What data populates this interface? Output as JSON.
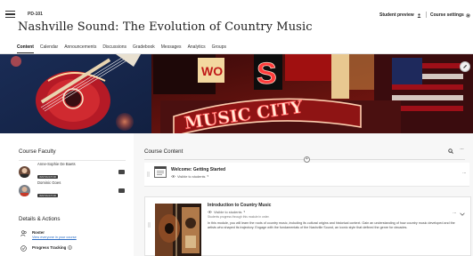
{
  "header": {
    "course_code": "PD-101",
    "course_title": "Nashville Sound: The Evolution of Country Music",
    "student_preview": "Student preview",
    "course_settings": "Course settings"
  },
  "nav": {
    "tabs": [
      "Content",
      "Calendar",
      "Announcements",
      "Discussions",
      "Gradebook",
      "Messages",
      "Analytics",
      "Groups"
    ],
    "active": "Content"
  },
  "banner": {
    "sign_top": "MUSIC",
    "sign_word": "MUSIC CITY"
  },
  "faculty": {
    "title": "Course Faculty",
    "members": [
      {
        "name": "Anne-Sophie De Baets",
        "role": "INSTRUCTOR"
      },
      {
        "name": "Dominic Goes",
        "role": "INSTRUCTOR"
      }
    ]
  },
  "details": {
    "title": "Details & Actions",
    "roster_title": "Roster",
    "roster_link": "View everyone in your course",
    "progress_title": "Progress Tracking"
  },
  "content": {
    "title": "Course Content",
    "welcome": {
      "title": "Welcome: Getting Started",
      "visibility": "Visible to students"
    },
    "intro": {
      "title": "Introduction to Country Music",
      "visibility": "Visible to students",
      "progress_note": "Students progress through this module in order.",
      "description": "In this module, you will learn the roots of country music, including its cultural origins and historical context. Gain an understanding of how country music developed and the artists who shaped its trajectory. Engage with the fundamentals of the Nashville Sound, an iconic style that defined the genre for decades."
    }
  },
  "colors": {
    "accent_link": "#2a6cc4",
    "banner_sign_red": "#b01c1c",
    "badge_dark": "#3a3a3a"
  }
}
